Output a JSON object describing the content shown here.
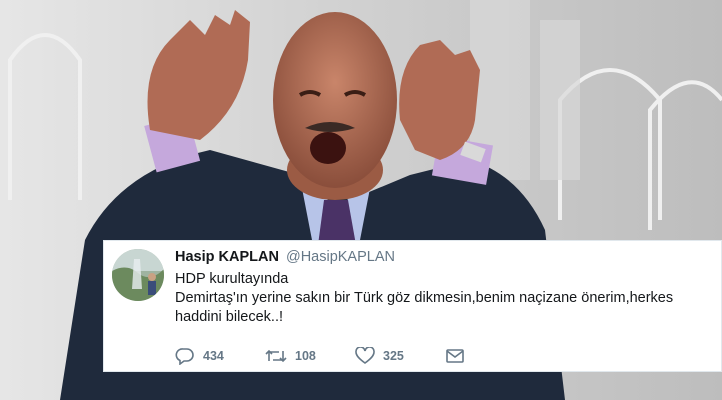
{
  "tweet": {
    "display_name": "Hasip KAPLAN",
    "handle": "@HasipKAPLAN",
    "text_lines": [
      "HDP kurultayında",
      "Demirtaş'ın yerine sakın  bir Türk göz dikmesin,benim naçizane önerim,herkes",
      "haddini bilecek..!"
    ],
    "reply_count": "434",
    "retweet_count": "108",
    "like_count": "325",
    "icons": {
      "reply": "reply-icon",
      "retweet": "retweet-icon",
      "like": "heart-icon",
      "message": "envelope-icon"
    }
  },
  "colors": {
    "card_bg": "#ffffff",
    "muted_text": "#657786",
    "body_text": "#14171a"
  }
}
